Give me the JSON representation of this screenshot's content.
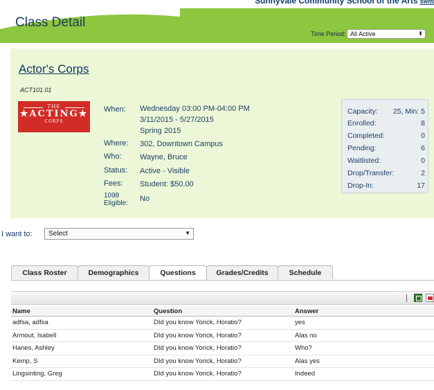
{
  "header": {
    "org_name": "Sunnyvale Community School of the Arts",
    "switch_label": "switch",
    "page_title": "Class Detail",
    "time_period_label": "Time Period:",
    "time_period_value": "All Active"
  },
  "course": {
    "title": "Actor's Corps",
    "code": "ACT101.01",
    "logo": {
      "top": "THE",
      "main": "★ACTING★",
      "bottom": "CORPS"
    },
    "labels": {
      "when": "When:",
      "where": "Where:",
      "who": "Who:",
      "status": "Status:",
      "fees": "Fees:",
      "eligible_1": "1098",
      "eligible_2": "Eligible:"
    },
    "values": {
      "when_time": "Wednesday 03:00 PM-04:00 PM",
      "when_dates": "3/11/2015 - 5/27/2015",
      "when_term": "Spring 2015",
      "where": "302, Downtown Campus",
      "who": "Wayne, Bruce",
      "status": "Active - Visible",
      "fees": "Student: $50.00",
      "eligible": "No"
    }
  },
  "stats": [
    {
      "label": "Capacity:",
      "value": "25, Min: 5"
    },
    {
      "label": "Enrolled:",
      "value": "8"
    },
    {
      "label": "Completed:",
      "value": "0"
    },
    {
      "label": "Pending:",
      "value": "6"
    },
    {
      "label": "Waitlisted:",
      "value": "0"
    },
    {
      "label": "Drop/Transfer:",
      "value": "2"
    },
    {
      "label": "Drop-In:",
      "value": "17"
    }
  ],
  "actions": {
    "want_label": "I want to:",
    "select_value": "Select"
  },
  "tabs": [
    {
      "label": "Class Roster"
    },
    {
      "label": "Demographics"
    },
    {
      "label": "Questions"
    },
    {
      "label": "Grades/Credits"
    },
    {
      "label": "Schedule"
    }
  ],
  "table": {
    "headers": [
      "Name",
      "Question",
      "Answer"
    ],
    "rows": [
      [
        "adfsa, adfsa",
        "DId you know Yorick, Horatio?",
        "yes"
      ],
      [
        "Armout, Isabell",
        "DId you know Yorick, Horatio?",
        "Alas no"
      ],
      [
        "Hanes, Ashley",
        "DId you know Yorick, Horatio?",
        "Who?"
      ],
      [
        "Kemp, S",
        "DId you know Yorick, Horatio?",
        "Alas yes"
      ],
      [
        "Lingsinting, Greg",
        "DId you know Yorick, Horatio?",
        "Indeed"
      ]
    ]
  },
  "colors": {
    "header_green": "#8dc63f",
    "panel_green": "#ecf7d8",
    "logo_red": "#d12c26",
    "link_blue": "#10355e"
  }
}
